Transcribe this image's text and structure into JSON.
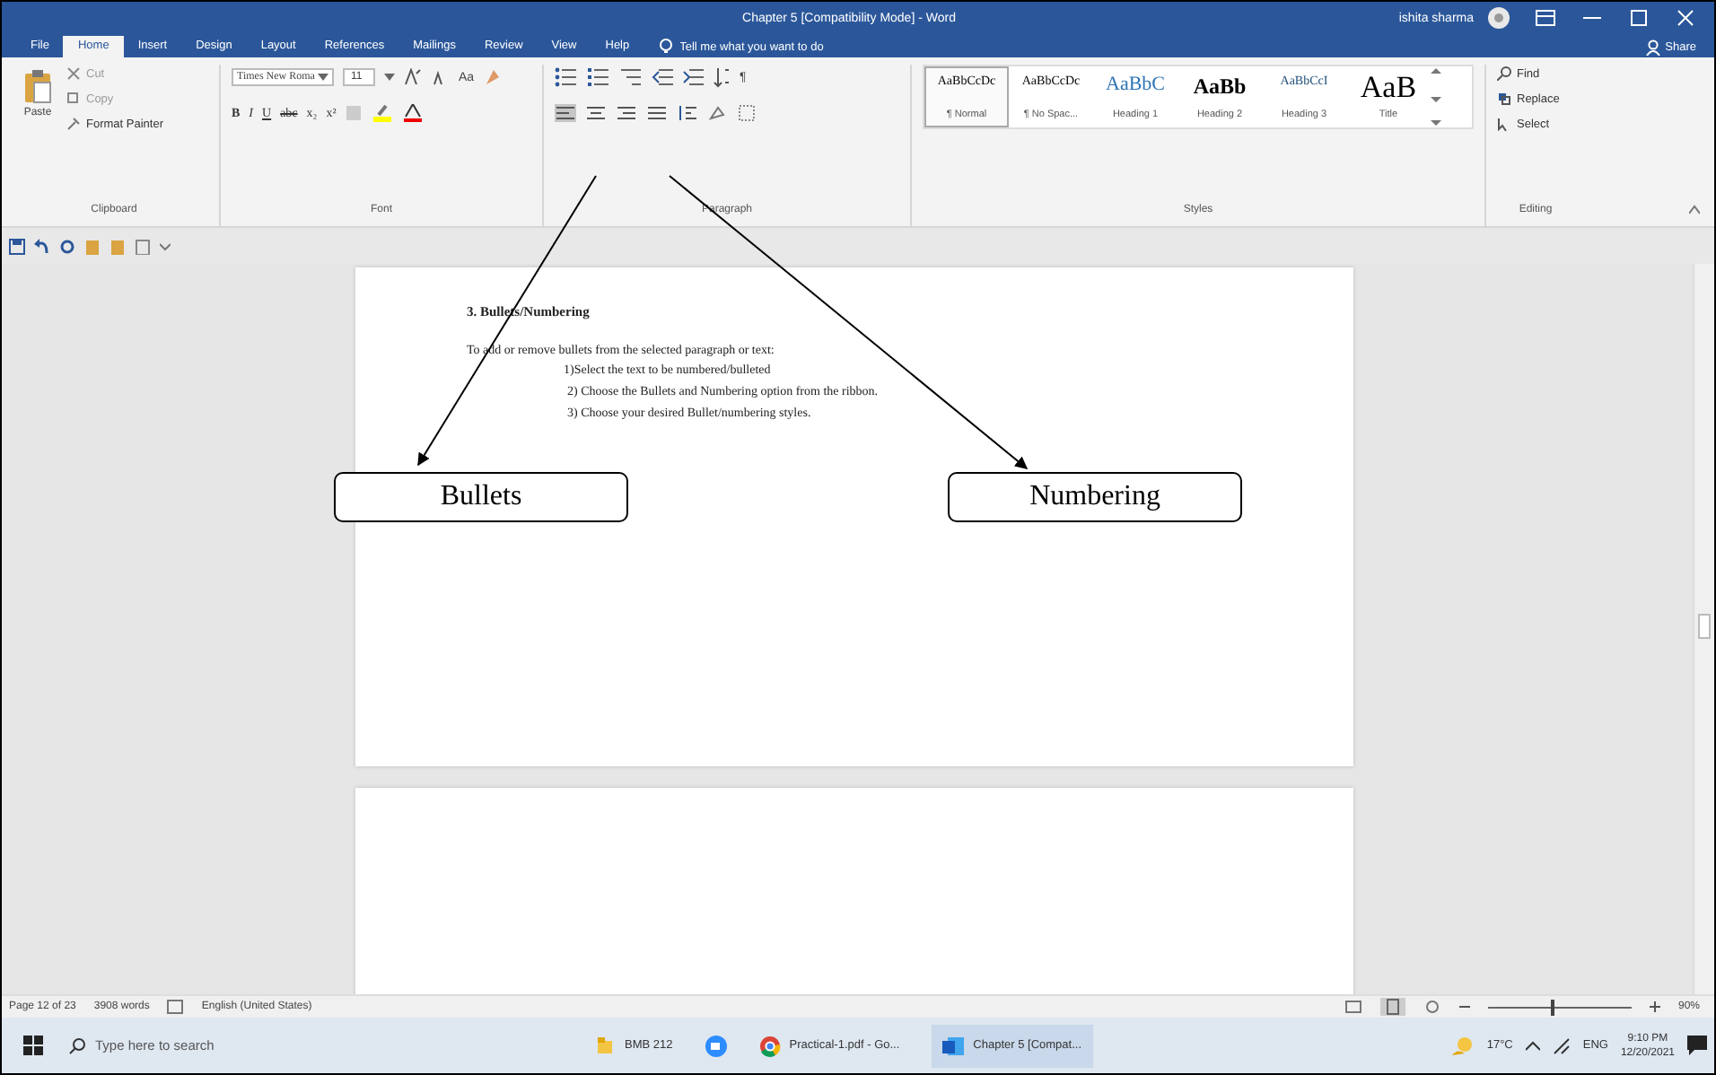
{
  "window": {
    "title": "Chapter 5 [Compatibility Mode] - Word",
    "user": "ishita sharma"
  },
  "tabs": [
    {
      "label": "File",
      "selected": false
    },
    {
      "label": "Home",
      "selected": true
    },
    {
      "label": "Insert",
      "selected": false
    },
    {
      "label": "Design",
      "selected": false
    },
    {
      "label": "Layout",
      "selected": false
    },
    {
      "label": "References",
      "selected": false
    },
    {
      "label": "Mailings",
      "selected": false
    },
    {
      "label": "Review",
      "selected": false
    },
    {
      "label": "View",
      "selected": false
    },
    {
      "label": "Help",
      "selected": false
    }
  ],
  "tell_me": {
    "placeholder": "Tell me what you want to do"
  },
  "share": "Share",
  "ribbon": {
    "clipboard": {
      "paste": "Paste",
      "cut": "Cut",
      "copy": "Copy",
      "format_painter": "Format Painter",
      "label": "Clipboard"
    },
    "font": {
      "name": "Times New Roma",
      "size": "11",
      "change_case": "Aa",
      "format_buttons": [
        "B",
        "I",
        "U",
        "abc",
        "x₂",
        "x²"
      ],
      "label": "Font"
    },
    "paragraph": {
      "pilcrow": "¶",
      "label": "Paragraph"
    },
    "styles": {
      "items": [
        {
          "sample": "AaBbCcDc",
          "name": "¶ Normal",
          "selected": true,
          "kind": "small"
        },
        {
          "sample": "AaBbCcDc",
          "name": "¶ No Spac...",
          "selected": false,
          "kind": "small"
        },
        {
          "sample": "AaBbC",
          "name": "Heading 1",
          "selected": false,
          "kind": "h1"
        },
        {
          "sample": "AaBb",
          "name": "Heading 2",
          "selected": false,
          "kind": "h2"
        },
        {
          "sample": "AaBbCcI",
          "name": "Heading 3",
          "selected": false,
          "kind": "h3"
        },
        {
          "sample": "AaB",
          "name": "Title",
          "selected": false,
          "kind": "title"
        }
      ],
      "label": "Styles"
    },
    "editing": {
      "find": "Find",
      "replace": "Replace",
      "select": "Select",
      "label": "Editing"
    }
  },
  "document": {
    "heading": "3. Bullets/Numbering",
    "intro": "To add or remove bullets from the selected paragraph or text:",
    "steps": [
      "1)Select the text to be numbered/bulleted",
      "2) Choose the Bullets and Numbering option from the ribbon.",
      "3) Choose your desired Bullet/numbering styles."
    ]
  },
  "annotations": [
    {
      "label": "Bullets"
    },
    {
      "label": "Numbering"
    }
  ],
  "status_bar": {
    "page": "Page 12 of 23",
    "words": "3908 words",
    "language": "English (United States)",
    "zoom": {
      "level": 0.45,
      "reading": "90%"
    }
  },
  "taskbar": {
    "search": {
      "placeholder": "Type here to search"
    },
    "items": [
      {
        "label": "BMB 212",
        "kind": "folder",
        "selected": false
      },
      {
        "label": "Practical-1.pdf - Go...",
        "kind": "chrome",
        "selected": false
      },
      {
        "label": "Chapter 5 [Compat...",
        "kind": "word",
        "selected": true
      }
    ],
    "weather": "17°C",
    "language": "ENG",
    "time": "9:10 PM",
    "date": "12/20/2021"
  }
}
